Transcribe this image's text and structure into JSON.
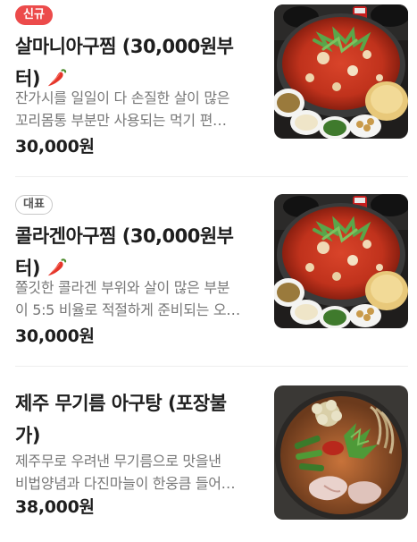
{
  "menu": {
    "items": [
      {
        "badge": "신규",
        "badge_type": "new",
        "title_line1": "살마니아구찜 (30,000원부",
        "title_line2": "터)",
        "spicy_icon": "chili-pepper-icon",
        "desc_line1": "잔가시를 일일이 다 손질한 살이 많은",
        "desc_line2": "꼬리몸통 부분만 사용되는 먹기 편…",
        "price": "30,000원",
        "image_icon": "spicy-braised-monkfish-photo"
      },
      {
        "badge": "대표",
        "badge_type": "rep",
        "title_line1": "콜라겐아구찜 (30,000원부",
        "title_line2": "터)",
        "spicy_icon": "chili-pepper-icon",
        "desc_line1": "쫄깃한 콜라겐 부위와 살이 많은 부분",
        "desc_line2": "이 5:5 비율로 적절하게 준비되는 오…",
        "price": "30,000원",
        "image_icon": "spicy-braised-monkfish-photo"
      },
      {
        "title_line1": "제주 무기름 아구탕 (포장불",
        "title_line2": "가)",
        "desc_line1": "제주무로 우려낸 무기름으로 맛을낸",
        "desc_line2": "비법양념과 다진마늘이 한웅큼 들어…",
        "price": "38,000원",
        "image_icon": "monkfish-hotpot-photo"
      }
    ]
  },
  "colors": {
    "badge_new": "#ec4b4b",
    "badge_rep_border": "#c8c8c8",
    "title": "#1e1e1e",
    "desc": "#777777",
    "divider": "#eeeeee"
  }
}
